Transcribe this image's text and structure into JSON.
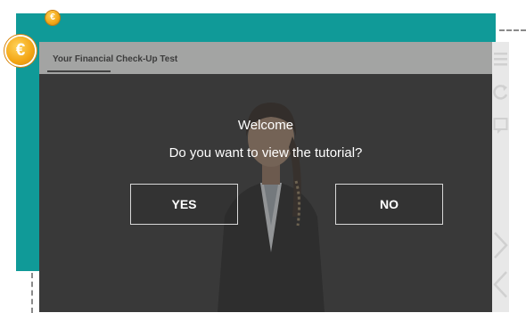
{
  "window": {
    "title": "Your Financial Check-Up Test"
  },
  "dialog": {
    "heading": "Welcome",
    "question": "Do you want to view the tutorial?",
    "yes_label": "YES",
    "no_label": "NO"
  },
  "badges": {
    "coin_symbol": "€"
  },
  "sidebar": {
    "icons": [
      "menu-icon",
      "refresh-icon",
      "chat-icon",
      "next-icon",
      "prev-icon"
    ]
  },
  "colors": {
    "teal": "#109a98",
    "coin": "#f3a514",
    "overlay": "#3e3e3e"
  }
}
